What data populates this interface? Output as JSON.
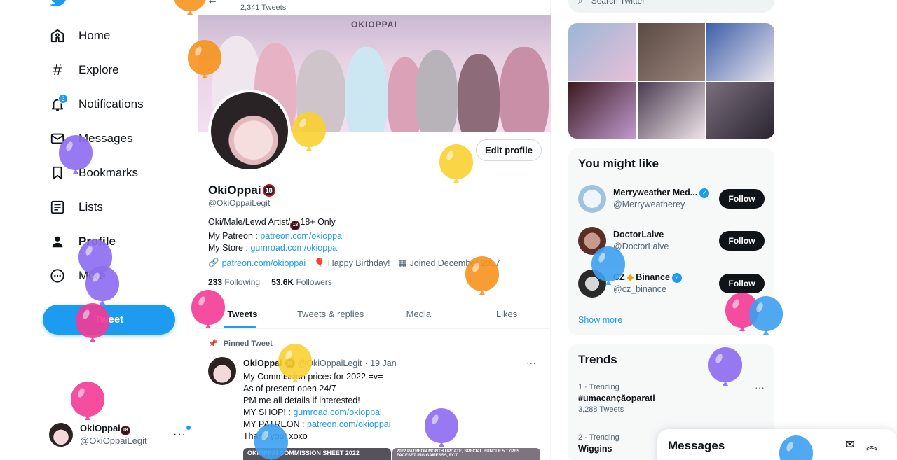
{
  "nav": {
    "items": [
      {
        "label": "Home",
        "icon": "home-icon"
      },
      {
        "label": "Explore",
        "icon": "hashtag-icon"
      },
      {
        "label": "Notifications",
        "icon": "bell-icon",
        "badge": "3"
      },
      {
        "label": "Messages",
        "icon": "envelope-icon"
      },
      {
        "label": "Bookmarks",
        "icon": "bookmark-icon"
      },
      {
        "label": "Lists",
        "icon": "list-icon"
      },
      {
        "label": "Profile",
        "icon": "person-icon"
      },
      {
        "label": "More",
        "icon": "more-circle-icon"
      }
    ],
    "tweet_button": "Tweet",
    "account": {
      "name": "OkiOppai",
      "handle": "@OkiOppaiLegit",
      "badge": "18"
    }
  },
  "profile": {
    "tweet_count": "2,341 Tweets",
    "banner_title": "OKIOPPAI",
    "edit_button": "Edit profile",
    "name": "OkiOppai",
    "name_badge": "18",
    "handle": "@OkiOppaiLegit",
    "bio_line1": "Oki/Male/Lewd Artist/",
    "bio_line1_badge": "18",
    "bio_line1_end": "18+ Only",
    "bio_patreon_label": "My Patreon : ",
    "bio_patreon_link": "patreon.com/okioppai",
    "bio_store_label": "My Store : ",
    "bio_store_link": "gumroad.com/okioppai",
    "meta_link": "patreon.com/okioppai",
    "meta_birthday": "Happy Birthday!",
    "meta_joined": "Joined December 2017",
    "following_count": "233",
    "following_label": "Following",
    "followers_count": "53.6K",
    "followers_label": "Followers",
    "tabs": [
      "Tweets",
      "Tweets & replies",
      "Media",
      "Likes"
    ]
  },
  "pinned_tweet": {
    "pinned_label": "Pinned Tweet",
    "name": "OkiOppai",
    "badge": "18",
    "handle": "@OkiOppaiLegit",
    "date": "· 19 Jan",
    "line1": "My Commission prices for 2022 =v=",
    "line2": "As of present open 24/7",
    "line3": "PM me all details if interested!",
    "line4_label": "MY SHOP! : ",
    "line4_link": "gumroad.com/okioppai",
    "line5_label": "MY PATREON : ",
    "line5_link": "patreon.com/okioppai",
    "line6": "Thank you! xoxo",
    "media1": "OKIOPPAI COMMISSION SHEET 2022",
    "media2": "2022 PATREON MONTH UPDATE, SPECIAL BUNDLE 5 TYPES FACESET ING GAMESSS, ECT"
  },
  "sidebar": {
    "search_placeholder": "Search Twitter",
    "you_might_like": "You might like",
    "suggestions": [
      {
        "name": "Merryweather Med...",
        "handle": "@Merryweatherey",
        "verified": true,
        "button": "Follow"
      },
      {
        "name": "DoctorLalve",
        "handle": "@DoctorLalve",
        "verified": false,
        "button": "Follow"
      },
      {
        "name": "CZ",
        "name_suffix": "Binance",
        "handle": "@cz_binance",
        "verified": true,
        "button": "Follow"
      }
    ],
    "show_more": "Show more",
    "trends_title": "Trends",
    "trends": [
      {
        "rank": "1 · Trending",
        "name": "#umacançãoparati",
        "count": "3,288 Tweets"
      },
      {
        "rank": "2 · Trending",
        "name": "Wiggins"
      }
    ]
  },
  "messages_drawer": {
    "title": "Messages"
  },
  "colors": {
    "accent": "#1d9bf0",
    "text": "#0f1419",
    "muted": "#536471"
  }
}
